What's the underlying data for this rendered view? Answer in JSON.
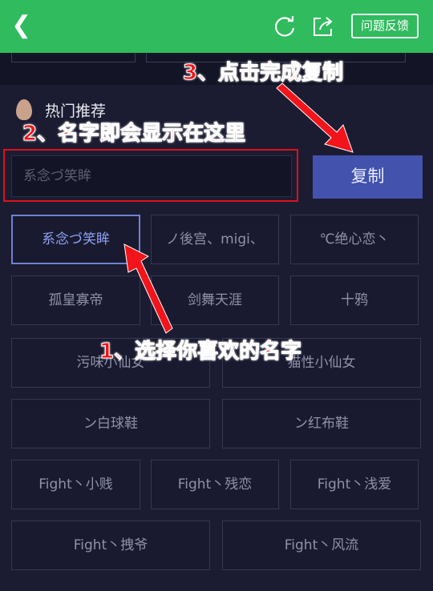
{
  "header": {
    "back_icon": "chevron-left-icon",
    "refresh_icon": "refresh-icon",
    "share_icon": "share-icon",
    "feedback_label": "问题反馈",
    "background": "#2fbb5e"
  },
  "section": {
    "title": "热门推荐",
    "icon": "flame-icon"
  },
  "name_input": {
    "value": "系念づ笑眸"
  },
  "copy_button": {
    "label": "复制",
    "color": "#4252ad"
  },
  "names": [
    "系念づ笑眸",
    "ノ後宫、migi、",
    "℃绝心恋丶",
    "孤皇寡帝",
    "剑舞天涯",
    "十鸦",
    "污味小仙女",
    "猫性小仙女",
    "ン白球鞋",
    "ン红布鞋",
    "Fight丶小贱",
    "Fight丶残恋",
    "Fight丶浅爱",
    "Fight丶拽爷",
    "Fight丶风流"
  ],
  "selected_name": "系念づ笑眸",
  "annotations": {
    "step1": "1、选择你喜欢的名字",
    "step2": "2、名字即会显示在这里",
    "step3": "3、点击完成复制",
    "color": "#f2141a"
  }
}
